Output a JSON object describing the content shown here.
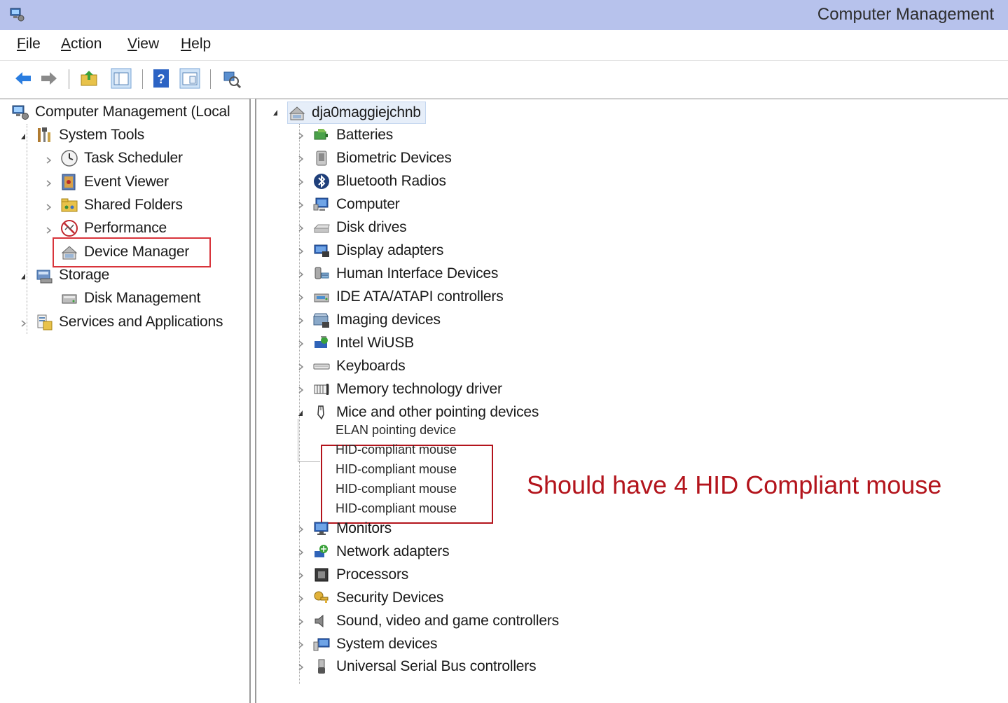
{
  "window": {
    "title": "Computer Management"
  },
  "menu": [
    "File",
    "Action",
    "View",
    "Help"
  ],
  "toolbar": {
    "buttons": [
      "back-icon",
      "forward-icon",
      "up-folder-icon",
      "show-hide-tree-icon",
      "help-icon",
      "properties-icon",
      "device-scan-icon"
    ]
  },
  "left_tree": {
    "root": "Computer Management (Local",
    "system_tools": "System Tools",
    "task_scheduler": "Task Scheduler",
    "event_viewer": "Event Viewer",
    "shared_folders": "Shared Folders",
    "performance": "Performance",
    "device_manager": "Device Manager",
    "storage": "Storage",
    "disk_management": "Disk Management",
    "services": "Services and Applications"
  },
  "device_tree": {
    "computer_name": "dja0maggiejchnb",
    "categories": [
      "Batteries",
      "Biometric Devices",
      "Bluetooth Radios",
      "Computer",
      "Disk drives",
      "Display adapters",
      "Human Interface Devices",
      "IDE ATA/ATAPI controllers",
      "Imaging devices",
      "Intel WiUSB",
      "Keyboards",
      "Memory technology driver",
      "Mice and other pointing devices"
    ],
    "mice_children": [
      "ELAN pointing device",
      "HID-compliant mouse",
      "HID-compliant mouse",
      "HID-compliant mouse",
      "HID-compliant mouse"
    ],
    "categories_after": [
      "Monitors",
      "Network adapters",
      "Processors",
      "Security Devices",
      "Sound, video and game controllers",
      "System devices",
      "Universal Serial Bus controllers"
    ]
  },
  "annotation": "Should have 4 HID Compliant mouse",
  "colors": {
    "titlebar": "#b7c2ec",
    "highlight": "#d8343b",
    "annotation": "#b3141c"
  }
}
